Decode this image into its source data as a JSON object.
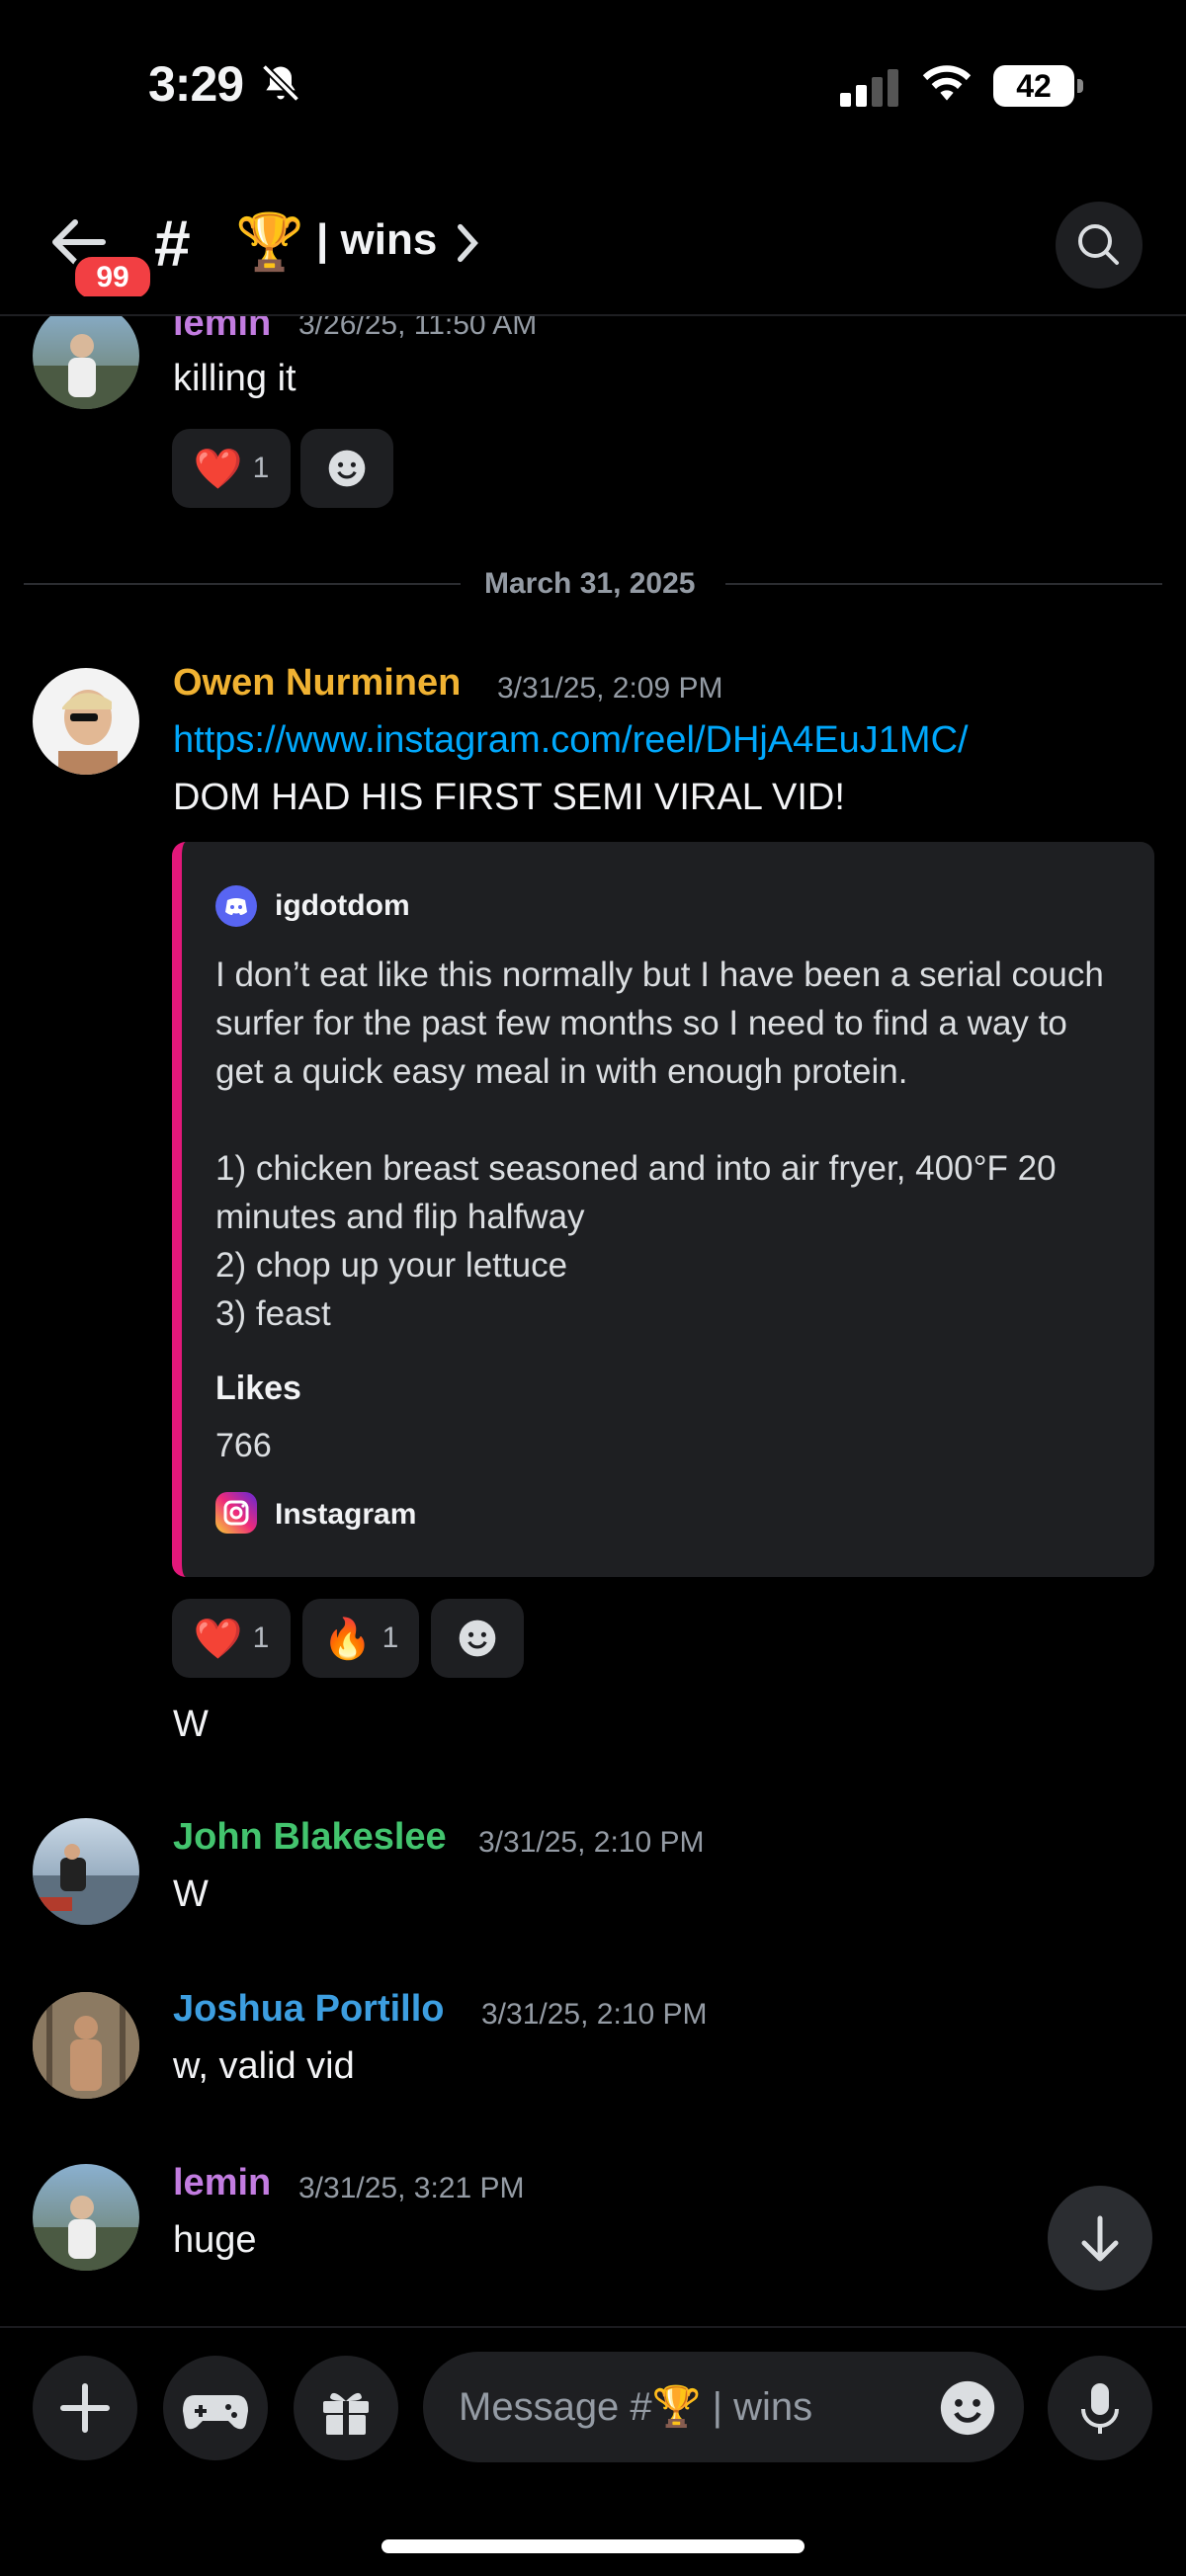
{
  "status_bar": {
    "time": "3:29",
    "battery": "42"
  },
  "header": {
    "unread_badge": "99",
    "hash_glyph": "#",
    "channel_emoji": "🏆",
    "channel_name": "| wins"
  },
  "messages": [
    {
      "author": "lemin",
      "timestamp": "3/26/25, 11:50 AM",
      "text": "killing it",
      "author_color": "#c27ce0",
      "reactions": [
        {
          "emoji": "❤️",
          "count": "1"
        }
      ]
    },
    {
      "author": "Owen Nurminen",
      "timestamp": "3/31/25, 2:09 PM",
      "author_color": "#f0b232",
      "link": "https://www.instagram.com/reel/DHjA4EuJ1MC/",
      "text": "DOM HAD HIS FIRST SEMI VIRAL VID!",
      "embed": {
        "author": "igdotdom",
        "description": "I don’t eat like this normally but I have been a serial couch surfer for the past few months so I need to find a way to get a quick easy meal in with enough protein.\n\n1) chicken breast seasoned and into air fryer, 400°F 20 minutes and flip halfway\n2) chop up your lettuce\n3) feast",
        "field_name": "Likes",
        "field_value": "766",
        "footer": "Instagram",
        "accent": "#e2187a"
      },
      "reactions": [
        {
          "emoji": "❤️",
          "count": "1"
        },
        {
          "emoji": "🔥",
          "count": "1"
        }
      ],
      "followup": "W"
    },
    {
      "author": "John Blakeslee",
      "timestamp": "3/31/25, 2:10 PM",
      "text": "W",
      "author_color": "#43c46e"
    },
    {
      "author": "Joshua Portillo",
      "timestamp": "3/31/25, 2:10 PM",
      "text": "w, valid vid",
      "author_color": "#3d9ee0"
    },
    {
      "author": "lemin",
      "timestamp": "3/31/25, 3:21 PM",
      "text": "huge",
      "author_color": "#c27ce0"
    }
  ],
  "date_divider": "March 31, 2025",
  "composer": {
    "placeholder_prefix": "Message #",
    "placeholder_emoji": "🏆",
    "placeholder_suffix": "| wins"
  },
  "icons": [
    "bell-slash-icon",
    "back-arrow-icon",
    "search-icon",
    "smile-add-reaction-icon",
    "plus-icon",
    "gamepad-icon",
    "gift-icon",
    "emoji-icon",
    "microphone-icon",
    "arrow-down-icon",
    "discord-icon",
    "instagram-icon"
  ]
}
